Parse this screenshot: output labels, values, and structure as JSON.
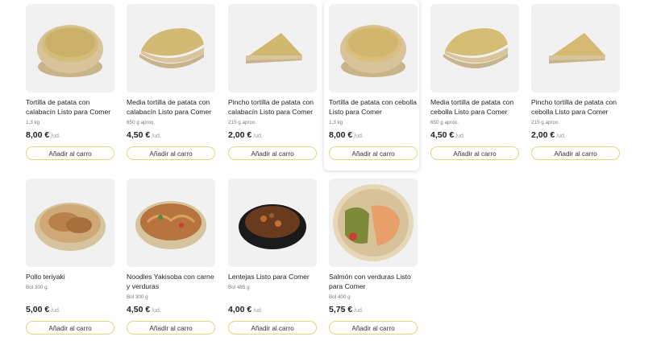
{
  "products": [
    {
      "name": "Tortilla de patata con calabacín Listo para Comer",
      "weight": "1,3 kg",
      "price": "8,00 €",
      "unit": "/ud.",
      "button": "Añadir al carro",
      "image": "round-tortilla-zucchini"
    },
    {
      "name": "Media tortilla de patata con calabacín Listo para Comer",
      "weight": "650 g aprox.",
      "price": "4,50 €",
      "unit": "/ud.",
      "button": "Añadir al carro",
      "image": "half-tortilla-zucchini"
    },
    {
      "name": "Pincho tortilla de patata con calabacín Listo para Comer",
      "weight": "215 g aprox.",
      "price": "2,00 €",
      "unit": "/ud.",
      "button": "Añadir al carro",
      "image": "wedge-tortilla-zucchini"
    },
    {
      "name": "Tortilla de patata con cebolla Listo para Comer",
      "weight": "1,3 kg",
      "price": "8,00 €",
      "unit": "/ud.",
      "button": "Añadir al carro",
      "image": "round-tortilla-onion"
    },
    {
      "name": "Media tortilla de patata con cebolla Listo para Comer",
      "weight": "650 g aprox.",
      "price": "4,50 €",
      "unit": "/ud.",
      "button": "Añadir al carro",
      "image": "half-tortilla-onion"
    },
    {
      "name": "Pincho tortilla de patata con cebolla Listo para Comer",
      "weight": "215 g aprox.",
      "price": "2,00 €",
      "unit": "/ud.",
      "button": "Añadir al carro",
      "image": "wedge-tortilla-onion"
    },
    {
      "name": "Pollo teriyaki",
      "weight": "Bol 300 g",
      "price": "5,00 €",
      "unit": "/ud.",
      "button": "Añadir al carro",
      "image": "chicken-teriyaki-bowl"
    },
    {
      "name": "Noodles Yakisoba con carne y verduras",
      "weight": "Bol 300 g",
      "price": "4,50 €",
      "unit": "/ud.",
      "button": "Añadir al carro",
      "image": "yakisoba-bowl"
    },
    {
      "name": "Lentejas Listo para Comer",
      "weight": "Bol 485 g",
      "price": "4,00 €",
      "unit": "/ud.",
      "button": "Añadir al carro",
      "image": "lentils-black-bowl"
    },
    {
      "name": "Salmón con verduras Listo para Comer",
      "weight": "Bol 400 g",
      "price": "5,75 €",
      "unit": "/ud.",
      "button": "Añadir al carro",
      "image": "salmon-vegetables-bowl"
    }
  ],
  "colors": {
    "button_border": "#e2d67d",
    "thumb_bg": "#f1f1f1"
  }
}
